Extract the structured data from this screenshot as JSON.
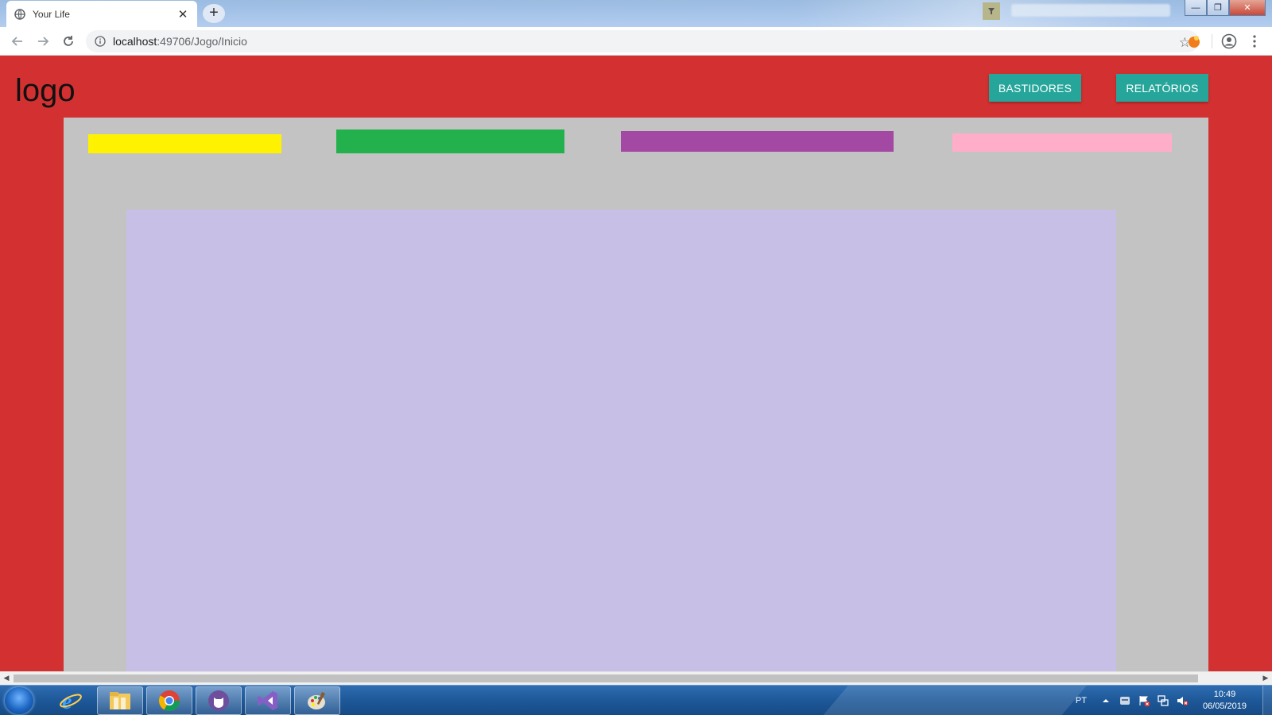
{
  "browser": {
    "tab_title": "Your Life",
    "tab_close": "✕",
    "new_tab": "+",
    "url_host": "localhost",
    "url_path": ":49706/Jogo/Inicio",
    "window_buttons": [
      "—",
      "❐",
      "✕"
    ]
  },
  "page": {
    "logo": "logo",
    "buttons": {
      "bastidores": "BASTIDORES",
      "relatorios": "RELATÓRIOS"
    },
    "bars": [
      {
        "name": "yellow",
        "color": "#fff200"
      },
      {
        "name": "green",
        "color": "#22b14c"
      },
      {
        "name": "purple",
        "color": "#a349a4"
      },
      {
        "name": "pink",
        "color": "#ffaec9"
      }
    ],
    "colors": {
      "background": "#d33131",
      "panel": "#c3c3c3",
      "board": "#c8bfe7",
      "button": "#26a69a"
    }
  },
  "taskbar": {
    "apps": [
      "internet-explorer-icon",
      "file-explorer-icon",
      "chrome-icon",
      "github-desktop-icon",
      "visual-studio-icon",
      "paint-icon"
    ],
    "language": "PT",
    "time": "10:49",
    "date": "06/05/2019"
  }
}
